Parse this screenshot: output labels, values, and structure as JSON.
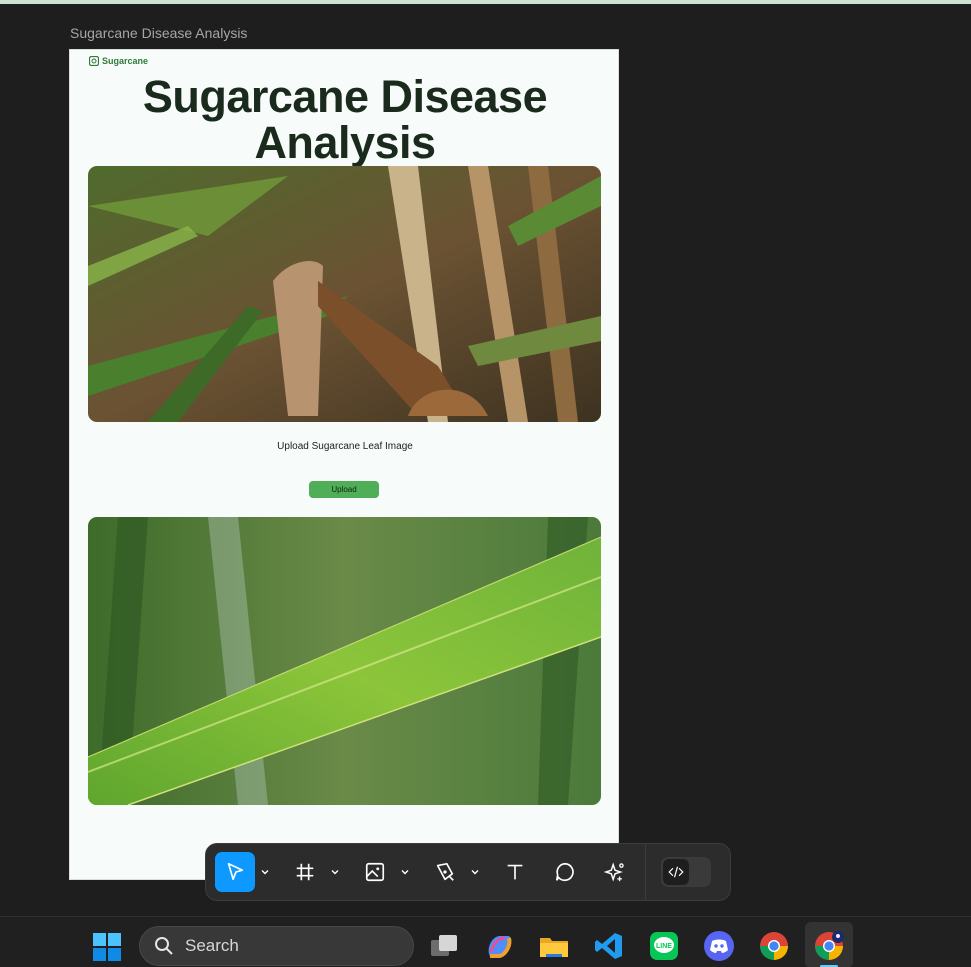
{
  "frame": {
    "label": "Sugarcane Disease Analysis"
  },
  "page": {
    "brand": "Sugarcane",
    "title": "Sugarcane Disease Analysis",
    "upload_label": "Upload Sugarcane Leaf Image",
    "upload_button": "Upload",
    "images": [
      {
        "subject": "dry sugarcane leaves with curled brown leaf"
      },
      {
        "subject": "green sugarcane leaf close-up"
      }
    ]
  },
  "toolbar": {
    "tools": [
      {
        "name": "move-tool",
        "icon": "cursor-arrow-icon",
        "active": true
      },
      {
        "name": "frame-tool",
        "icon": "frame-hash-icon",
        "active": false
      },
      {
        "name": "image-tool",
        "icon": "image-icon",
        "active": false
      },
      {
        "name": "pen-tool",
        "icon": "pen-icon",
        "active": false
      },
      {
        "name": "text-tool",
        "icon": "text-icon",
        "active": false
      },
      {
        "name": "comment-tool",
        "icon": "comment-icon",
        "active": false
      },
      {
        "name": "actions-tool",
        "icon": "sparkle-icon",
        "active": false
      }
    ],
    "dev_mode_icon": "code-icon",
    "active_color": "#0d99ff"
  },
  "taskbar": {
    "search_placeholder": "Search",
    "apps": [
      "windows-start-icon",
      "task-view-icon",
      "copilot-icon",
      "file-explorer-icon",
      "vscode-icon",
      "line-icon",
      "discord-icon",
      "chrome-icon",
      "chrome-profile-icon"
    ]
  },
  "colors": {
    "brand_green": "#2f7a3a",
    "button_green": "#4fae57",
    "title": "#1a2a1c"
  }
}
